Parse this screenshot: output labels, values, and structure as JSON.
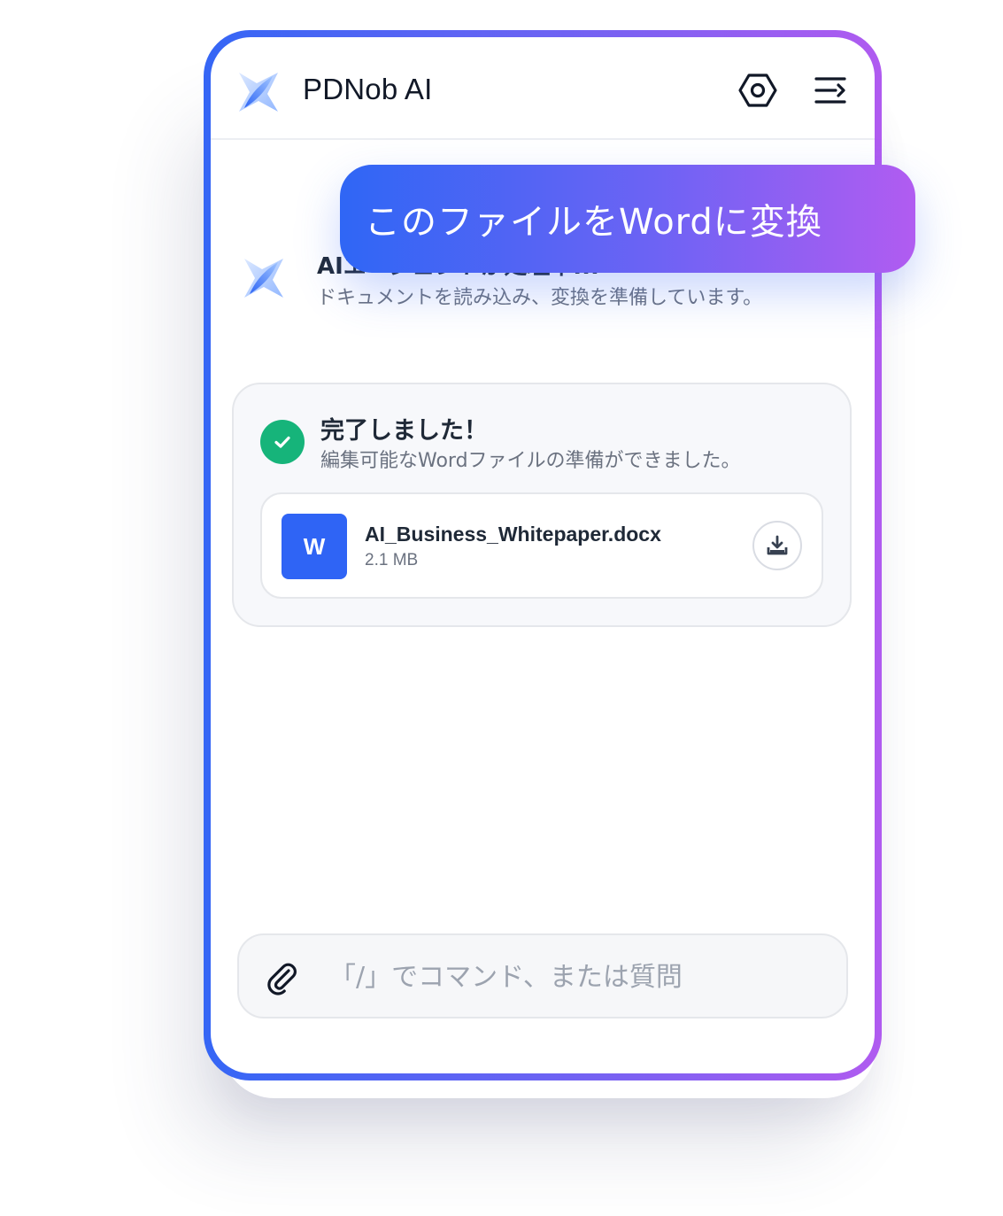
{
  "header": {
    "title": "PDNob AI",
    "logo_icon": "sparkle-star-icon",
    "settings_icon": "hex-gear-icon",
    "menu_icon": "menu-collapse-icon"
  },
  "user_message": {
    "text": "このファイルをWordに変換"
  },
  "agent_status": {
    "title": "AIエージェントが処理中...",
    "subtitle": "ドキュメントを読み込み、変換を準備しています。"
  },
  "completion": {
    "title": "完了しました！",
    "subtitle": "編集可能なWordファイルの準備ができました。",
    "file": {
      "badge": "W",
      "name": "AI_Business_Whitepaper.docx",
      "size": "2.1 MB"
    }
  },
  "composer": {
    "placeholder": "「/」でコマンド、または質問"
  },
  "colors": {
    "accent_blue": "#2f64f5",
    "accent_purple": "#b05bf0",
    "success_green": "#16b47a"
  }
}
